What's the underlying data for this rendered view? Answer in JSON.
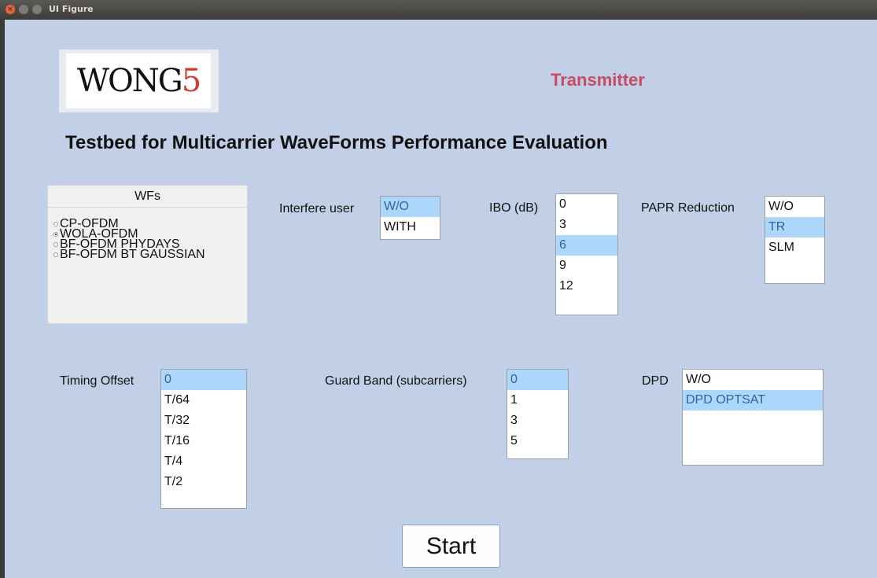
{
  "window": {
    "title": "UI Figure"
  },
  "logo": {
    "text_main": "WONG",
    "text_accent": "5"
  },
  "header": {
    "title": "Transmitter",
    "subtitle": "Testbed for Multicarrier WaveForms Performance Evaluation"
  },
  "wfs_panel": {
    "title": "WFs",
    "options": [
      {
        "label": "CP-OFDM",
        "selected": false
      },
      {
        "label": "WOLA-OFDM",
        "selected": true
      },
      {
        "label": "BF-OFDM PHYDAYS",
        "selected": false
      },
      {
        "label": "BF-OFDM BT GAUSSIAN",
        "selected": false
      }
    ]
  },
  "interfere_user": {
    "label": "Interfere user",
    "items": [
      "W/O",
      "WITH"
    ],
    "selected": "W/O"
  },
  "ibo": {
    "label": "IBO (dB)",
    "items": [
      "0",
      "3",
      "6",
      "9",
      "12"
    ],
    "selected": "6"
  },
  "papr": {
    "label": "PAPR Reduction",
    "items": [
      "W/O",
      "TR",
      "SLM"
    ],
    "selected": "TR"
  },
  "timing_offset": {
    "label": "Timing Offset",
    "items": [
      "0",
      "T/64",
      "T/32",
      "T/16",
      "T/4",
      "T/2"
    ],
    "selected": "0"
  },
  "guard_band": {
    "label": "Guard Band (subcarriers)",
    "items": [
      "0",
      "1",
      "3",
      "5"
    ],
    "selected": "0"
  },
  "dpd": {
    "label": "DPD",
    "items": [
      "W/O",
      "DPD OPTSAT"
    ],
    "selected": "DPD OPTSAT"
  },
  "start_button": {
    "label": "Start"
  }
}
